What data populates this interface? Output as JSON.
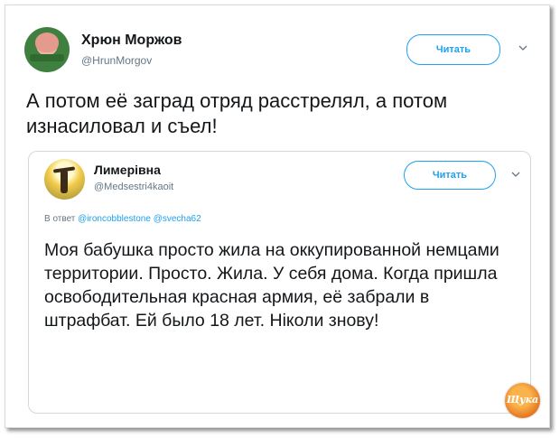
{
  "tweet": {
    "author_name": "Хрюн Моржов",
    "author_handle": "@HrunMorgov",
    "follow_label": "Читать",
    "text": "А потом её заград отряд расстрелял, а потом изнасиловал и съел!"
  },
  "quoted_tweet": {
    "author_name": "Лимерівна",
    "author_handle": "@Medsestri4kaoit",
    "follow_label": "Читать",
    "reply_prefix": "В ответ",
    "mentions": [
      "@ironcobblestone",
      "@svecha62"
    ],
    "text": "Моя бабушка просто жила на оккупированной немцами территории. Просто. Жила. У себя дома. Когда пришла освободительная красная армия, её забрали в штрафбат. Ей было 18 лет. Ніколи знову!"
  },
  "watermark": {
    "text": "Щука"
  },
  "colors": {
    "accent": "#1da1f2",
    "text": "#14171a",
    "muted": "#657786"
  }
}
